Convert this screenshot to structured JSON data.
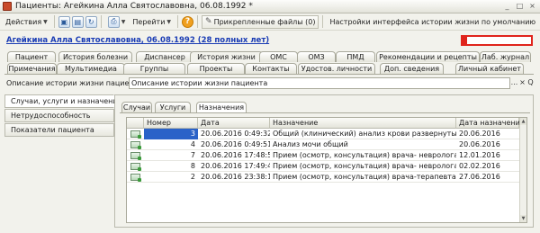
{
  "window": {
    "title": "Пациенты: Агейкина Алла Святославовна, 06.08.1992 *",
    "controls": [
      "_",
      "□",
      "×"
    ]
  },
  "toolbar": {
    "actions_label": "Действия",
    "goto_label": "Перейти",
    "help_symbol": "?",
    "attached_files_label": "Прикрепленные файлы (0)",
    "settings_label": "Настройки интерфейса истории жизни по умолчанию"
  },
  "patient": {
    "link_text": "Агейкина Алла Святославовна, 06.08.1992   (28 полных лет)"
  },
  "main_tabs_row1": [
    "Пациент",
    "История болезни",
    "Диспансер",
    "История жизни",
    "ОМС",
    "ОМЗ",
    "ПМД",
    "Рекомендации и рецепты",
    "Лаб. журнал"
  ],
  "main_tabs_row2": [
    "Примечания",
    "Мультимедиа",
    "Группы",
    "Проекты",
    "Контакты",
    "Удостов. личности",
    "Доп. сведения",
    "Личный кабинет"
  ],
  "description": {
    "label": "Описание истории жизни пациента:",
    "value": "Описание истории жизни пациента",
    "btn_more": "...",
    "btn_clear": "×",
    "btn_open": "Q"
  },
  "left_panel": {
    "items": [
      "Случаи, услуги и назначения",
      "Нетрудоспособность",
      "Показатели пациента"
    ]
  },
  "sub_tabs": [
    "Случаи",
    "Услуги",
    "Назначения"
  ],
  "grid": {
    "columns": [
      "Номер",
      "Дата",
      "Назначение",
      "Дата назначения"
    ],
    "rows": [
      {
        "num": "3",
        "date": "20.06.2016 0:49:32",
        "purpose": "Общий (клинический) анализ крови развернутый*",
        "pdate": "20.06.2016"
      },
      {
        "num": "4",
        "date": "20.06.2016 0:49:51",
        "purpose": "Анализ мочи общий",
        "pdate": "20.06.2016"
      },
      {
        "num": "7",
        "date": "20.06.2016 17:48:59",
        "purpose": "Прием (осмотр, консультация) врача- невролога перви...",
        "pdate": "12.01.2016"
      },
      {
        "num": "8",
        "date": "20.06.2016 17:49:43",
        "purpose": "Прием (осмотр, консультация) врача- невролога повто...",
        "pdate": "02.02.2016"
      },
      {
        "num": "2",
        "date": "20.06.2016 23:38:10",
        "purpose": "Прием (осмотр, консультация) врача-терапевта повто...",
        "pdate": "27.06.2016"
      }
    ]
  }
}
